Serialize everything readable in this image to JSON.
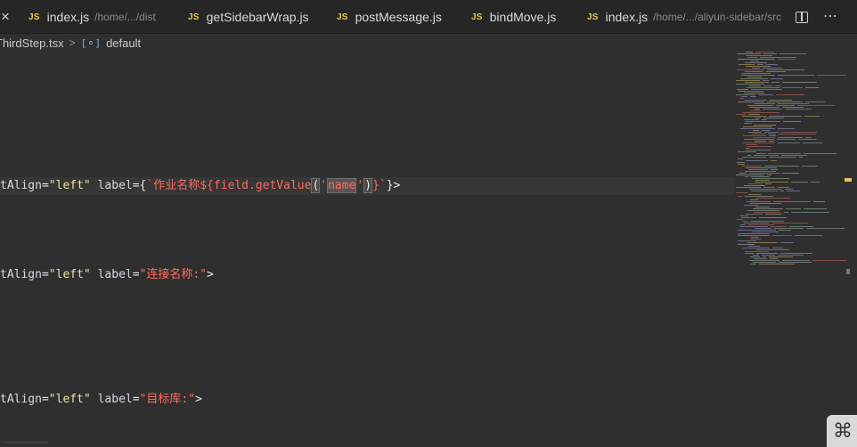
{
  "tabs": [
    {
      "icon": "JS",
      "name": "index.js",
      "path": "/home/.../dist"
    },
    {
      "icon": "JS",
      "name": "getSidebarWrap.js",
      "path": ""
    },
    {
      "icon": "JS",
      "name": "postMessage.js",
      "path": ""
    },
    {
      "icon": "JS",
      "name": "bindMove.js",
      "path": ""
    },
    {
      "icon": "JS",
      "name": "index.js",
      "path": "/home/.../aliyun-sidebar/src"
    }
  ],
  "tab_close_glyph": "×",
  "breadcrumb": {
    "file": "ThirdStep.tsx",
    "separator": ">",
    "symbol_icon": "[⚬]",
    "symbol": "default"
  },
  "code": {
    "line1": {
      "attr1": "tAlign",
      "eq1": "=",
      "val1": "\"left\"",
      "attr2": " label",
      "eq2": "={",
      "tick_open": "`",
      "tpl_text": "作业名称${field.getValue",
      "paren_open": "(",
      "q1": "'",
      "selected": "name",
      "q2": "'",
      "paren_close": ")",
      "brace_close": "}",
      "tick_close": "`",
      "end": "}>"
    },
    "line2": {
      "attr1": "tAlign",
      "eq1": "=",
      "val1": "\"left\"",
      "attr2": " label",
      "eq2": "=",
      "val2": "\"连接名称:\"",
      "end": ">"
    },
    "line3": {
      "attr1": "tAlign",
      "eq1": "=",
      "val1": "\"left\"",
      "attr2": " label",
      "eq2": "=",
      "val2": "\"目标库:\"",
      "end": ">"
    }
  },
  "colors": {
    "editor_bg": "#2f2f2f",
    "string": "#e9e3a6",
    "template_string": "#ff6b5e",
    "js_icon": "#e4c84b",
    "scrollbar_highlight": "#e1c35a"
  },
  "icons": {
    "split_editor": "split-editor-icon",
    "more_actions": "more-actions-icon",
    "command": "⌘"
  }
}
